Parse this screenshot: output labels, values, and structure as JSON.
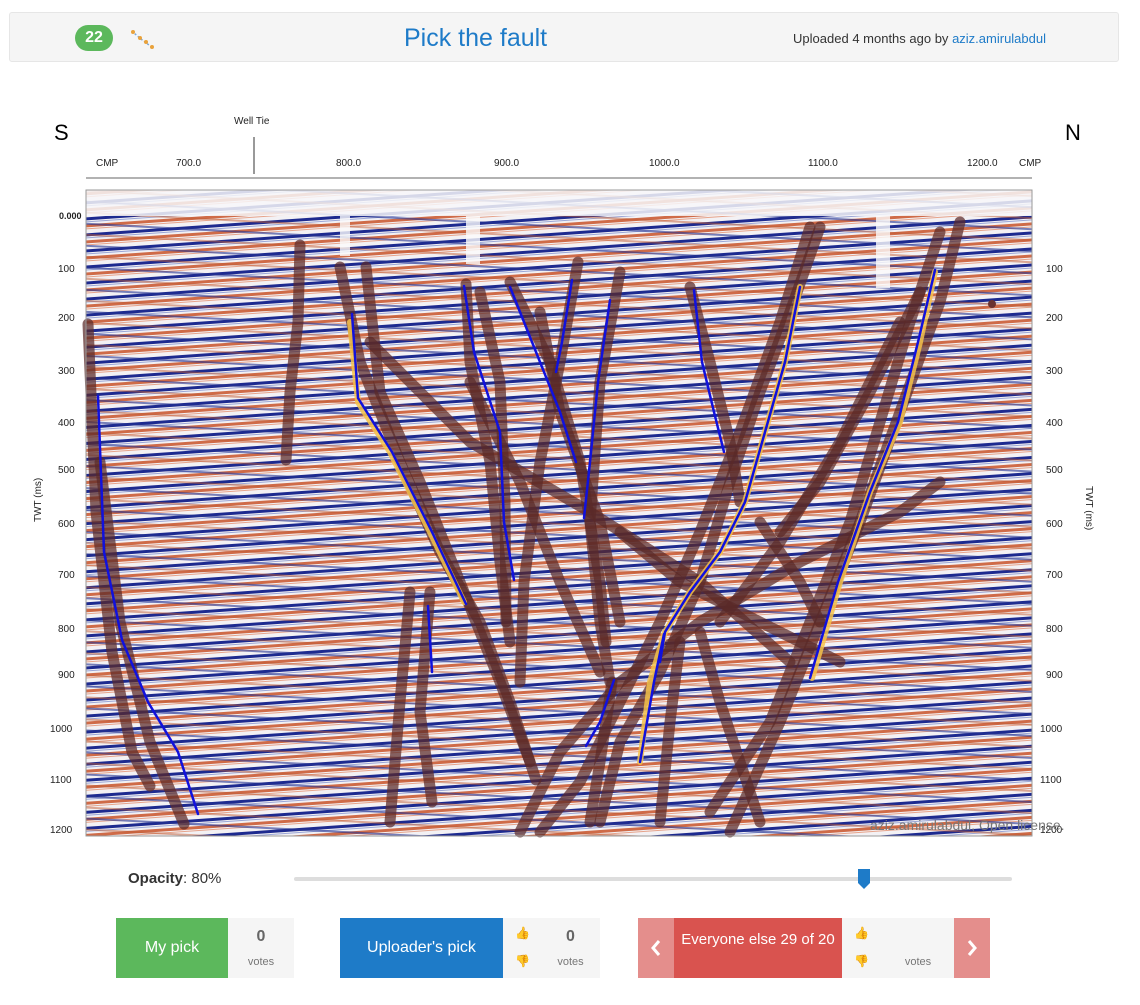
{
  "header": {
    "count": "22",
    "title": "Pick the fault",
    "uploaded_prefix": "Uploaded 4 months ago by",
    "uploader": "aziz.amirulabdul"
  },
  "section": {
    "left_dir": "S",
    "right_dir": "N",
    "well_tie": "Well Tie",
    "cmp_label": "CMP",
    "cmp_ticks": [
      "700.0",
      "800.0",
      "900.0",
      "1000.0",
      "1100.0",
      "1200.0"
    ],
    "zero_label": "0.000",
    "twt_ticks": [
      "100",
      "200",
      "300",
      "400",
      "500",
      "600",
      "700",
      "800",
      "900",
      "1000",
      "1100",
      "1200"
    ],
    "twt_axis_label": "TWT (ms)",
    "attribution": "aziz.amirulabdul, Open license."
  },
  "opacity": {
    "label": "Opacity",
    "value": ": 80%",
    "level": 0.8
  },
  "my_pick": {
    "label": "My pick",
    "votes": "0",
    "votes_label": "votes"
  },
  "uploader_pick": {
    "label": "Uploader's pick",
    "votes": "0",
    "votes_label": "votes"
  },
  "everyone": {
    "label": "Everyone else 29 of 20",
    "votes_label": "votes"
  },
  "colors": {
    "accent": "#1e7bc8",
    "green": "#5cb85c",
    "red": "#d9534f",
    "red_light": "#e48e8c"
  }
}
